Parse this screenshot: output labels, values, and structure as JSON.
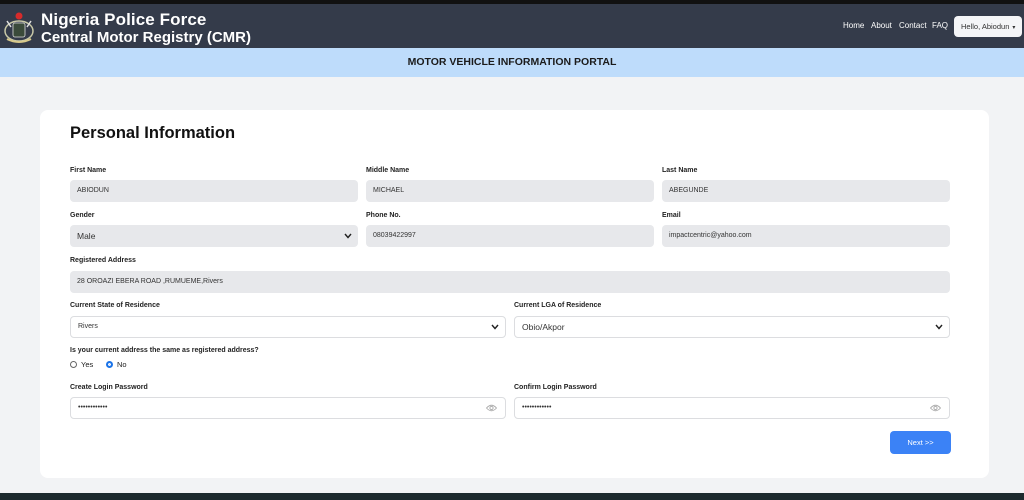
{
  "header": {
    "brand_line1": "Nigeria Police Force",
    "brand_line2": "Central Motor Registry (CMR)",
    "nav": [
      "Home",
      "About",
      "Contact",
      "FAQ"
    ],
    "user_menu": "Hello, Abiodun"
  },
  "banner": "MOTOR VEHICLE INFORMATION PORTAL",
  "form": {
    "title": "Personal Information",
    "first_name": {
      "label": "First Name",
      "value": "ABIODUN"
    },
    "middle_name": {
      "label": "Middle Name",
      "value": "MICHAEL"
    },
    "last_name": {
      "label": "Last Name",
      "value": "ABEGUNDE"
    },
    "gender": {
      "label": "Gender",
      "value": "Male"
    },
    "phone": {
      "label": "Phone No.",
      "value": "08039422997"
    },
    "email": {
      "label": "Email",
      "value": "impactcentric@yahoo.com"
    },
    "address": {
      "label": "Registered Address",
      "value": "28 OROAZI EBERA ROAD ,RUMUEME,Rivers"
    },
    "state": {
      "label": "Current State of Residence",
      "value": "Rivers"
    },
    "lga": {
      "label": "Current LGA of Residence",
      "value": "Obio/Akpor"
    },
    "same_address": {
      "question": "Is your current address the same as registered address?",
      "yes": "Yes",
      "no": "No",
      "selected": "No"
    },
    "password": {
      "label": "Create Login Password",
      "value": "••••••••••••"
    },
    "confirm_password": {
      "label": "Confirm Login Password",
      "value": "••••••••••••"
    },
    "next_button": "Next >>"
  },
  "colors": {
    "header": "#343b4a",
    "banner": "#bedcfb",
    "accent": "#3b82f6"
  }
}
